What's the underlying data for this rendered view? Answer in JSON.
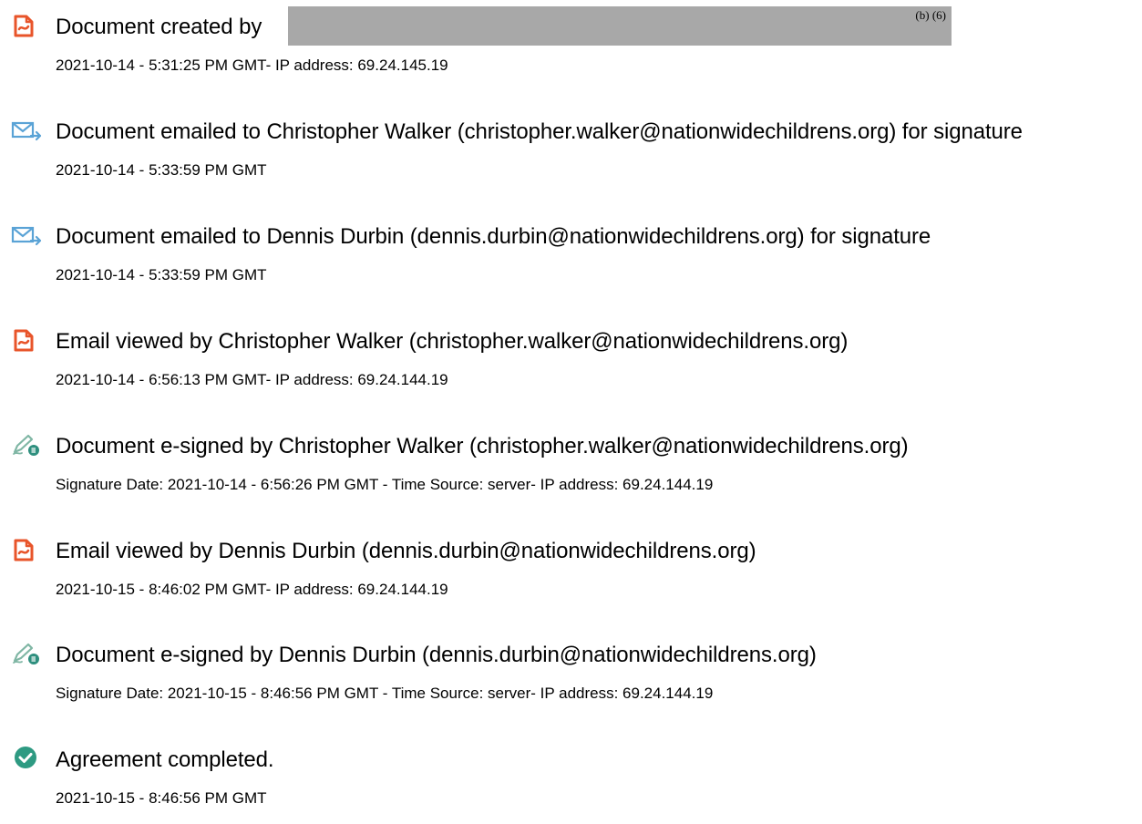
{
  "colors": {
    "document_icon": "#e8542a",
    "email_icon": "#5aa3d6",
    "esign_pen": "#7fb6a4",
    "esign_badge": "#2e8f7e",
    "completed_icon": "#2e9a82",
    "redaction": "#a8a8a8"
  },
  "events": [
    {
      "icon": "document-icon",
      "headline": "Document created by",
      "redaction_code": "(b) (6)",
      "detail": "2021-10-14 - 5:31:25 PM GMT- IP address: 69.24.145.19"
    },
    {
      "icon": "email-sent-icon",
      "headline": "Document emailed to Christopher Walker (christopher.walker@nationwidechildrens.org) for signature",
      "detail": "2021-10-14 - 5:33:59 PM GMT"
    },
    {
      "icon": "email-sent-icon",
      "headline": "Document emailed to Dennis Durbin (dennis.durbin@nationwidechildrens.org) for signature",
      "detail": "2021-10-14 - 5:33:59 PM GMT"
    },
    {
      "icon": "document-icon",
      "headline": "Email viewed by Christopher Walker (christopher.walker@nationwidechildrens.org)",
      "detail": "2021-10-14 - 6:56:13 PM GMT- IP address: 69.24.144.19"
    },
    {
      "icon": "esign-pen-icon",
      "headline": "Document e-signed by Christopher Walker (christopher.walker@nationwidechildrens.org)",
      "detail": "Signature Date: 2021-10-14 - 6:56:26 PM GMT - Time Source: server- IP address: 69.24.144.19"
    },
    {
      "icon": "document-icon",
      "headline": "Email viewed by Dennis Durbin (dennis.durbin@nationwidechildrens.org)",
      "detail": "2021-10-15 - 8:46:02 PM GMT- IP address: 69.24.144.19"
    },
    {
      "icon": "esign-pen-icon",
      "headline": "Document e-signed by Dennis Durbin (dennis.durbin@nationwidechildrens.org)",
      "detail": "Signature Date: 2021-10-15 - 8:46:56 PM GMT - Time Source: server- IP address: 69.24.144.19"
    },
    {
      "icon": "check-circle-icon",
      "headline": "Agreement completed.",
      "detail": "2021-10-15 - 8:46:56 PM GMT"
    }
  ]
}
